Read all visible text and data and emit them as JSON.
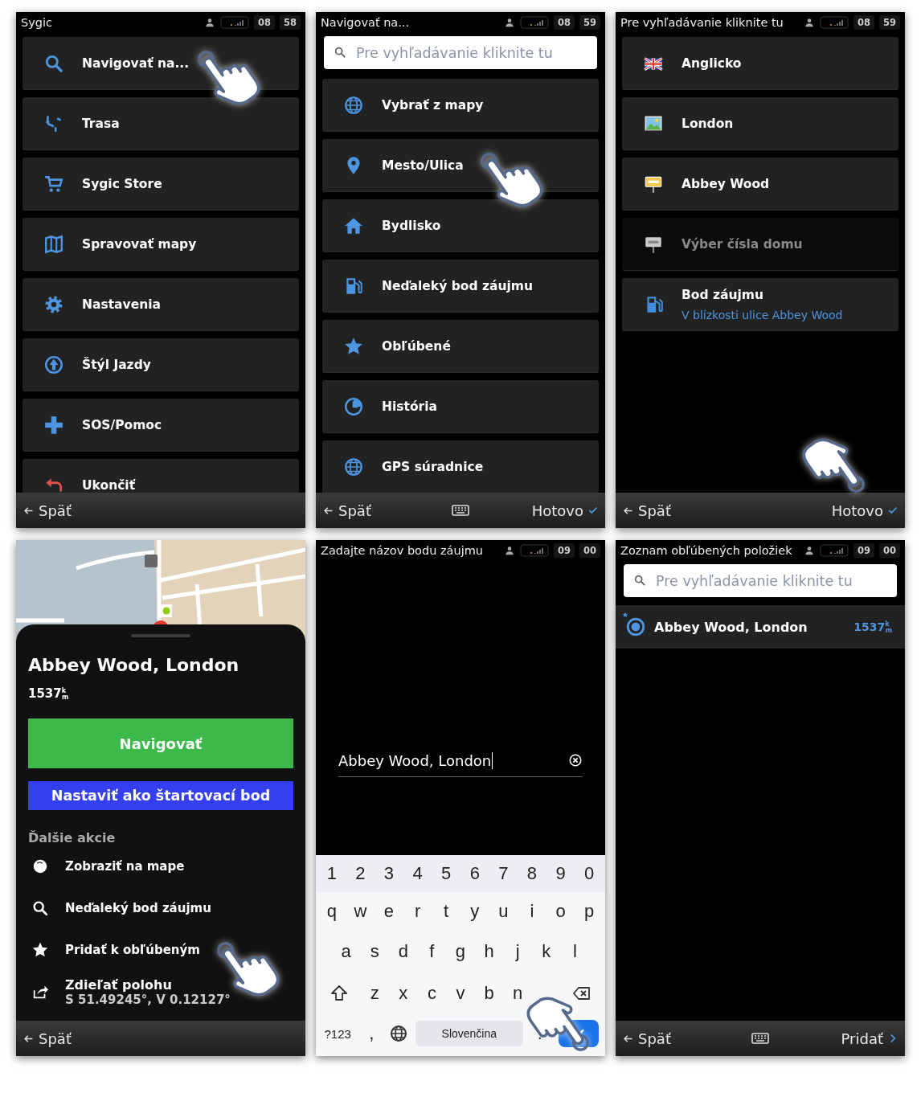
{
  "screens": [
    {
      "kind": "menu",
      "status_bar": {
        "title": "Sygic",
        "hour": "08",
        "minute": "58"
      },
      "items": [
        {
          "label": "Navigovať na..."
        },
        {
          "label": "Trasa"
        },
        {
          "label": "Sygic Store"
        },
        {
          "label": "Spravovať mapy"
        },
        {
          "label": "Nastavenia"
        },
        {
          "label": "Štýl Jazdy"
        },
        {
          "label": "SOS/Pomoc"
        },
        {
          "label": "Ukončiť"
        }
      ],
      "bottom_bar": {
        "back": "Späť"
      }
    },
    {
      "kind": "search_menu",
      "status_bar": {
        "title": "Navigovať na...",
        "hour": "08",
        "minute": "59"
      },
      "search": {
        "placeholder": "Pre vyhľadávanie kliknite tu"
      },
      "items": [
        {
          "label": "Vybrať z mapy"
        },
        {
          "label": "Mesto/Ulica"
        },
        {
          "label": "Bydlisko"
        },
        {
          "label": "Neďaleký bod záujmu"
        },
        {
          "label": "Obľúbené"
        },
        {
          "label": "História"
        },
        {
          "label": "GPS súradnice"
        }
      ],
      "bottom_bar": {
        "back": "Späť",
        "keyboard": true,
        "action": "Hotovo"
      }
    },
    {
      "kind": "results",
      "status_bar": {
        "title": "Pre vyhľadávanie kliknite tu",
        "hour": "08",
        "minute": "59"
      },
      "items": [
        {
          "label": "Anglicko",
          "disabled": false
        },
        {
          "label": "London",
          "disabled": false
        },
        {
          "label": "Abbey Wood",
          "disabled": false
        },
        {
          "label": "Výber čísla domu",
          "disabled": true
        },
        {
          "label": "Bod záujmu",
          "subtitle": "V blízkosti ulice Abbey Wood",
          "disabled": false
        }
      ],
      "bottom_bar": {
        "back": "Späť",
        "action": "Hotovo"
      }
    },
    {
      "kind": "place",
      "map": {
        "kind": "picture"
      },
      "title": "Abbey Wood, London",
      "distance": "1537$^{k}$$_{m}$",
      "primary_button": "Navigovať",
      "secondary_button": "Nastaviť ako štartovací bod",
      "section_title": "Ďalšie akcie",
      "actions": [
        {
          "label": "Zobraziť na mape"
        },
        {
          "label": "Neďaleký bod záujmu"
        },
        {
          "label": "Pridať k obľúbeným"
        },
        {
          "label": "Zdieľať polohu",
          "subtitle": "S 51.49245°, V 0.12127°"
        }
      ],
      "bottom_bar": {
        "back": "Späť"
      }
    },
    {
      "kind": "text_entry",
      "status_bar": {
        "title": "Zadajte názov bodu záujmu",
        "hour": "09",
        "minute": "00"
      },
      "input": {
        "value": "Abbey Wood, London"
      },
      "keyboard": {
        "number_row": [
          "1",
          "2",
          "3",
          "4",
          "5",
          "6",
          "7",
          "8",
          "9",
          "0"
        ],
        "rows": [
          [
            "q",
            "w",
            "e",
            "r",
            "t",
            "y",
            "u",
            "i",
            "o",
            "p"
          ],
          [
            "a",
            "s",
            "d",
            "f",
            "g",
            "h",
            "j",
            "k",
            "l"
          ],
          [
            "z",
            "x",
            "c",
            "v",
            "b",
            "n"
          ]
        ],
        "symbols_key": "?123",
        "comma_key": ",",
        "space_key": "Slovenčina",
        "period_key": "."
      }
    },
    {
      "kind": "favorites",
      "status_bar": {
        "title": "Zoznam obľúbených položiek",
        "hour": "09",
        "minute": "00"
      },
      "search": {
        "placeholder": "Pre vyhľadávanie kliknite tu"
      },
      "favorites": [
        {
          "label": "Abbey Wood, London",
          "distance": "1537$^{k}$$_{m}$"
        }
      ],
      "bottom_bar": {
        "back": "Späť",
        "keyboard": true,
        "action": "Pridať"
      }
    }
  ]
}
